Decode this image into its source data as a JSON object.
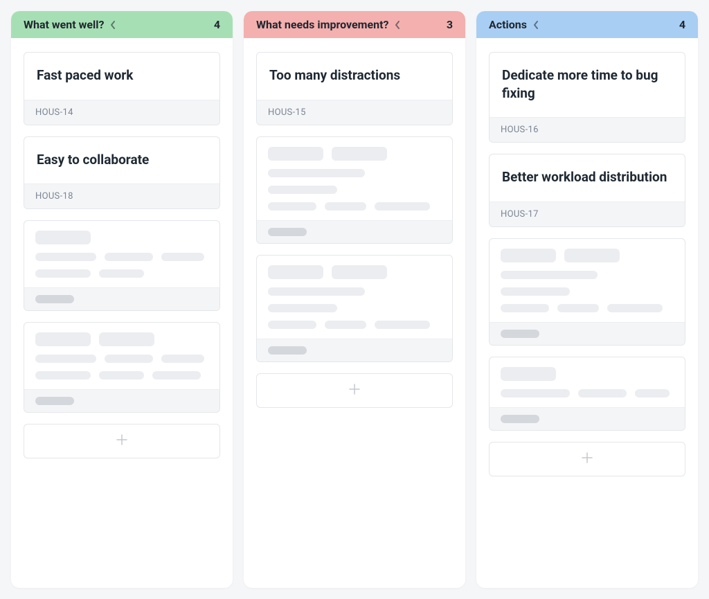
{
  "columns": [
    {
      "id": "went-well",
      "title": "What went well?",
      "count": 4,
      "headerClass": "h-green",
      "cards": [
        {
          "title": "Fast paced work",
          "key": "HOUS-14"
        },
        {
          "title": "Easy to collaborate",
          "key": "HOUS-18"
        }
      ],
      "skeletons": [
        {
          "header": [
            80
          ],
          "rows": [
            [
              88,
              70,
              62
            ],
            [
              80,
              65
            ]
          ],
          "footer": true
        },
        {
          "header": [
            80,
            80
          ],
          "rows": [
            [
              88,
              70,
              62
            ],
            [
              80,
              65,
              70
            ]
          ],
          "footer": true
        }
      ],
      "add": true
    },
    {
      "id": "improvement",
      "title": "What needs improvement?",
      "count": 3,
      "headerClass": "h-red",
      "cards": [
        {
          "title": "Too many distractions",
          "key": "HOUS-15"
        }
      ],
      "skeletons": [
        {
          "header": [
            80,
            80
          ],
          "rows": [
            [
              140,
              100
            ],
            [
              70,
              60,
              80
            ]
          ],
          "footer": true
        },
        {
          "header": [
            80,
            80
          ],
          "rows": [
            [
              140,
              100
            ],
            [
              70,
              60,
              80
            ]
          ],
          "footer": true
        }
      ],
      "add": true
    },
    {
      "id": "actions",
      "title": "Actions",
      "count": 4,
      "headerClass": "h-blue",
      "cards": [
        {
          "title": "Dedicate more time to bug fixing",
          "key": "HOUS-16"
        },
        {
          "title": "Better workload distribution",
          "key": "HOUS-17"
        }
      ],
      "skeletons": [
        {
          "header": [
            80,
            80
          ],
          "rows": [
            [
              140,
              100
            ],
            [
              70,
              60,
              80
            ]
          ],
          "footer": true
        },
        {
          "header": [
            80
          ],
          "rows": [
            [
              100,
              70,
              50
            ]
          ],
          "footer": true
        }
      ],
      "add": true
    }
  ]
}
